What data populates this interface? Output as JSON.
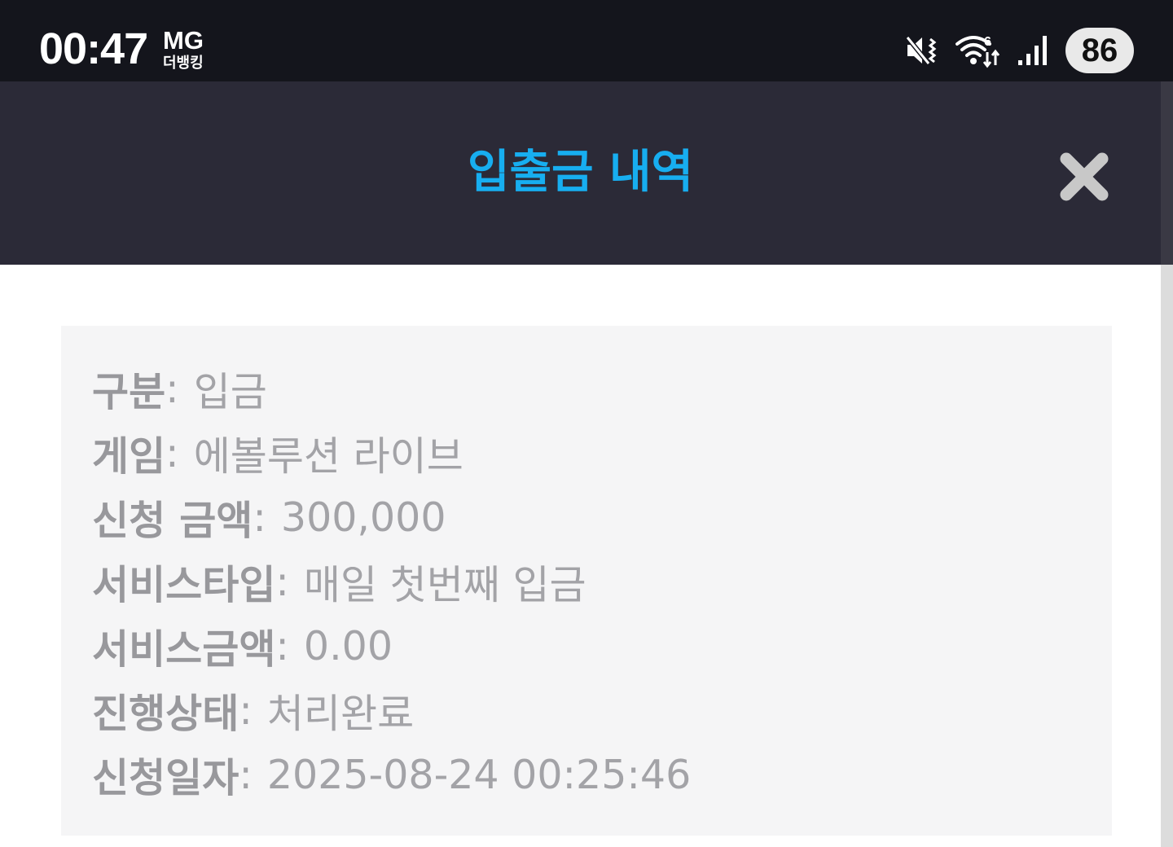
{
  "status_bar": {
    "time": "00:47",
    "carrier_top": "MG",
    "carrier_bottom": "더뱅킹",
    "battery": "86",
    "icons": [
      "mute-vibrate-icon",
      "wifi-6-icon",
      "signal-icon"
    ]
  },
  "header": {
    "title": "입출금 내역",
    "close_icon": "close-x-icon"
  },
  "details": {
    "separator": ":",
    "rows": [
      {
        "label": "구분",
        "value": "입금"
      },
      {
        "label": "게임",
        "value": "에볼루션 라이브"
      },
      {
        "label": "신청 금액",
        "value": "300,000"
      },
      {
        "label": "서비스타입",
        "value": "매일 첫번째 입금"
      },
      {
        "label": "서비스금액",
        "value": "0.00"
      },
      {
        "label": "진행상태",
        "value": "처리완료"
      },
      {
        "label": "신청일자",
        "value": "2025-08-24 00:25:46"
      }
    ]
  },
  "colors": {
    "status_bar_bg": "#14151c",
    "header_bg": "#2b2a37",
    "title": "#17aef0",
    "card_bg": "#f5f5f6",
    "text": "#a3a3a7"
  }
}
